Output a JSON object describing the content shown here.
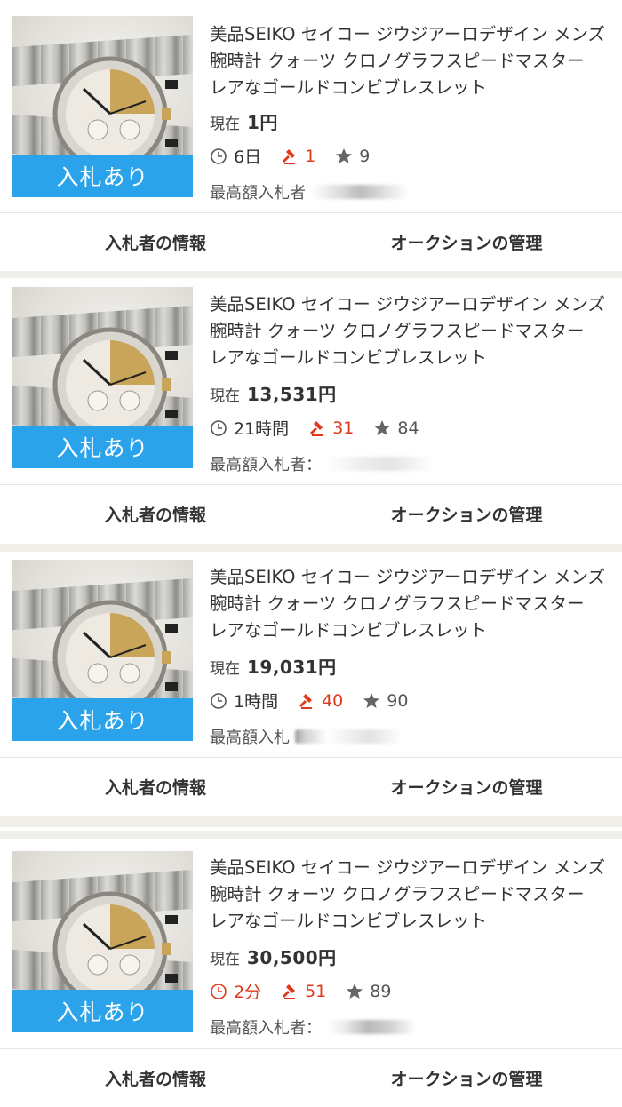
{
  "items": [
    {
      "title": "美品SEIKO セイコー ジウジアーロデザイン メンズ腕時計 クォーツ クロノグラフスピードマスター レアなゴールドコンビブレスレット",
      "bid_badge": "入札あり",
      "price_label": "現在",
      "price": "1円",
      "time_left": "6日",
      "time_urgent": false,
      "bids": "1",
      "watchers": "9",
      "top_bidder_label": "最高額入札者"
    },
    {
      "title": "美品SEIKO セイコー ジウジアーロデザイン メンズ腕時計 クォーツ クロノグラフスピードマスター レアなゴールドコンビブレスレット",
      "bid_badge": "入札あり",
      "price_label": "現在",
      "price": "13,531円",
      "time_left": "21時間",
      "time_urgent": false,
      "bids": "31",
      "watchers": "84",
      "top_bidder_label": "最高額入札者："
    },
    {
      "title": "美品SEIKO セイコー ジウジアーロデザイン メンズ腕時計 クォーツ クロノグラフスピードマスター レアなゴールドコンビブレスレット",
      "bid_badge": "入札あり",
      "price_label": "現在",
      "price": "19,031円",
      "time_left": "1時間",
      "time_urgent": false,
      "bids": "40",
      "watchers": "90",
      "top_bidder_label": "最高額入札"
    },
    {
      "title": "美品SEIKO セイコー ジウジアーロデザイン メンズ腕時計 クォーツ クロノグラフスピードマスター レアなゴールドコンビブレスレット",
      "bid_badge": "入札あり",
      "price_label": "現在",
      "price": "30,500円",
      "time_left": "2分",
      "time_urgent": true,
      "bids": "51",
      "watchers": "89",
      "top_bidder_label": "最高額入札者："
    }
  ],
  "actions": {
    "bidder_info": "入札者の情報",
    "manage_auction": "オークションの管理"
  },
  "icons": {
    "time": "clock-icon",
    "bids": "gavel-icon",
    "watch": "star-icon"
  },
  "colors": {
    "badge": "#2aa3ea",
    "bids_red": "#e0391b",
    "separator": "#f1efea"
  }
}
